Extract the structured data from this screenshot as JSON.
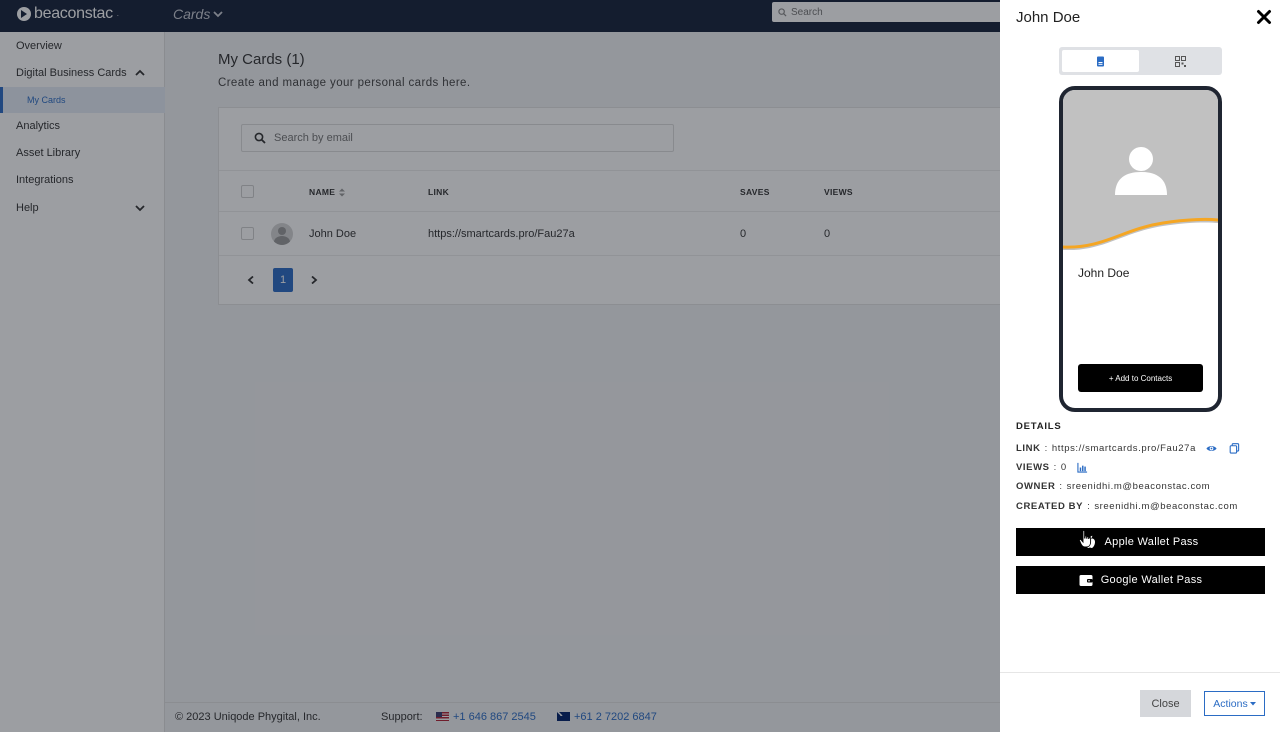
{
  "topbar": {
    "logo_text": "beaconstac",
    "product_label": "Cards",
    "search_placeholder": "Search"
  },
  "sidebar": {
    "items": [
      {
        "label": "Overview"
      },
      {
        "label": "Digital Business Cards"
      },
      {
        "label": "My Cards"
      },
      {
        "label": "Analytics"
      },
      {
        "label": "Asset Library"
      },
      {
        "label": "Integrations"
      },
      {
        "label": "Help"
      }
    ]
  },
  "main": {
    "title": "My Cards (1)",
    "subtitle": "Create and manage your personal cards here.",
    "search_placeholder": "Search by email",
    "columns": [
      "NAME",
      "LINK",
      "SAVES",
      "VIEWS"
    ],
    "rows": [
      {
        "name": "John Doe",
        "link": "https://smartcards.pro/Fau27a",
        "saves": "0",
        "views": "0"
      }
    ],
    "pagination": {
      "current": "1"
    }
  },
  "footer": {
    "copyright": "© 2023 Uniqode Phygital, Inc.",
    "support_label": "Support:",
    "phone_us": "+1 646 867 2545",
    "phone_au": "+61 2 7202 6847"
  },
  "drawer": {
    "title": "John Doe",
    "preview": {
      "card_name": "John Doe",
      "add_contact_label": "+ Add to Contacts"
    },
    "details_heading": "DETAILS",
    "details": {
      "link_label": "LINK",
      "link_value": "https://smartcards.pro/Fau27a",
      "views_label": "VIEWS",
      "views_value": "0",
      "owner_label": "OWNER",
      "owner_value": "sreenidhi.m@beaconstac.com",
      "created_by_label": "CREATED BY",
      "created_by_value": "sreenidhi.m@beaconstac.com"
    },
    "apple_wallet_label": "Apple Wallet Pass",
    "google_wallet_label": "Google Wallet Pass",
    "close_label": "Close",
    "actions_label": "Actions"
  },
  "colors": {
    "topbar": "#16213a",
    "accent": "#2b6cc4",
    "wave": "#f5a623"
  }
}
